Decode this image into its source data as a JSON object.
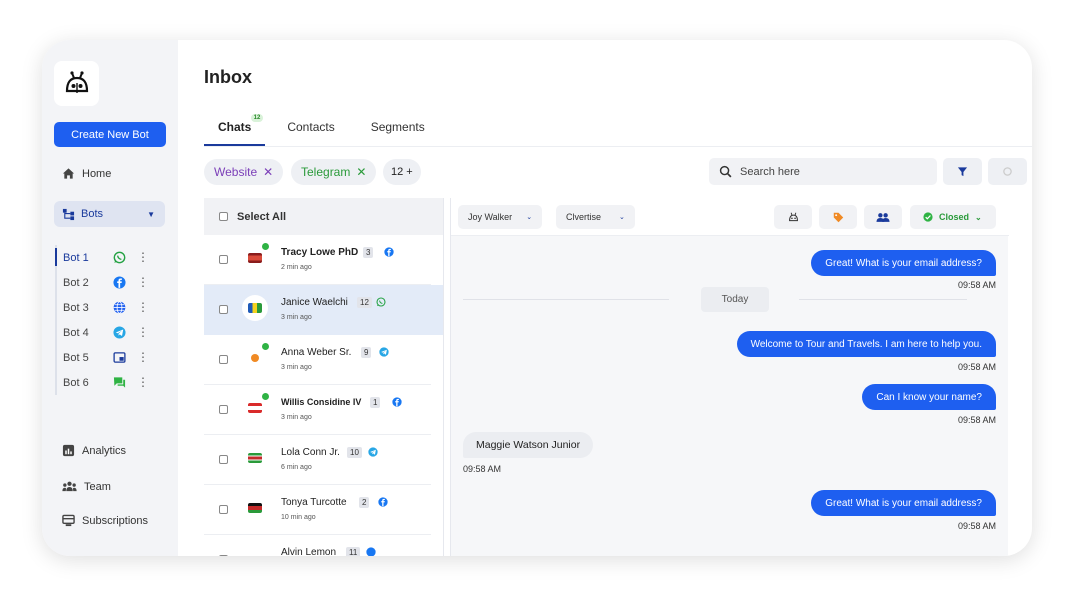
{
  "sidebar": {
    "create_label": "Create New Bot",
    "home_label": "Home",
    "bots_label": "Bots",
    "bots": [
      {
        "label": "Bot 1",
        "channel": "whatsapp-icon"
      },
      {
        "label": "Bot 2",
        "channel": "facebook-icon"
      },
      {
        "label": "Bot 3",
        "channel": "globe-icon"
      },
      {
        "label": "Bot 4",
        "channel": "telegram-icon"
      },
      {
        "label": "Bot 5",
        "channel": "widget-icon"
      },
      {
        "label": "Bot 6",
        "channel": "chat-icon"
      }
    ],
    "analytics_label": "Analytics",
    "team_label": "Team",
    "subscriptions_label": "Subscriptions"
  },
  "header": {
    "title": "Inbox"
  },
  "tabs": [
    {
      "label": "Chats",
      "badge": "12"
    },
    {
      "label": "Contacts"
    },
    {
      "label": "Segments"
    }
  ],
  "filters": {
    "chips": [
      {
        "label": "Website",
        "color": "#7b3fb8"
      },
      {
        "label": "Telegram",
        "color": "#2a9a3a"
      }
    ],
    "more": "12 +"
  },
  "search": {
    "placeholder": "Search here"
  },
  "chatlist": {
    "select_all": "Select All",
    "chats": [
      {
        "name": "Tracy Lowe PhD",
        "count": "3",
        "time": "2 min ago",
        "channel": "facebook-icon",
        "bold": true
      },
      {
        "name": "Janice Waelchi",
        "count": "12",
        "time": "3 min ago",
        "channel": "whatsapp-icon",
        "bold": false
      },
      {
        "name": "Anna Weber Sr.",
        "count": "9",
        "time": "3 min ago",
        "channel": "telegram-icon",
        "bold": false
      },
      {
        "name": "Willis Considine IV",
        "count": "1",
        "time": "3 min ago",
        "channel": "facebook-icon",
        "bold": true
      },
      {
        "name": "Lola Conn Jr.",
        "count": "10",
        "time": "6 min ago",
        "channel": "telegram-icon",
        "bold": false
      },
      {
        "name": "Tonya Turcotte",
        "count": "2",
        "time": "10 min ago",
        "channel": "facebook-icon",
        "bold": false
      },
      {
        "name": "Alvin Lemon",
        "count": "11",
        "time": "",
        "channel": "facebook-icon",
        "bold": false
      }
    ]
  },
  "conversation": {
    "agent": "Joy Walker",
    "bot": "Clvertise",
    "status": "Closed",
    "today": "Today",
    "messages": [
      {
        "text": "Great! What is your email address?",
        "time": "09:58 AM"
      },
      {
        "text": "Welcome to Tour and Travels. I am here to help you.",
        "time": "09:58 AM"
      },
      {
        "text": "Can I know your name?",
        "time": "09:58 AM"
      },
      {
        "text": "Maggie Watson Junior",
        "time": "09:58 AM"
      },
      {
        "text": "Great! What is your email address?",
        "time": "09:58 AM"
      }
    ]
  },
  "colors": {
    "accent": "#1e5ff0",
    "nav_active": "#1a3a9c",
    "online": "#2fb344"
  }
}
